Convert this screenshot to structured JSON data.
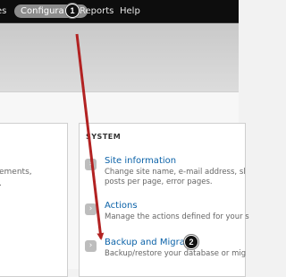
{
  "toolbar": {
    "items": [
      {
        "label": "es"
      },
      {
        "label": "Configuration"
      },
      {
        "label": "Reports"
      },
      {
        "label": "Help"
      }
    ]
  },
  "left_panel": {
    "lines": [
      "ements,",
      "."
    ]
  },
  "system": {
    "title": "SYSTEM",
    "items": [
      {
        "link": "Site information",
        "desc": [
          "Change site name, e-mail address, sl",
          "posts per page, error pages."
        ]
      },
      {
        "link": "Actions",
        "desc": [
          "Manage the actions defined for your s"
        ]
      },
      {
        "link": "Backup and Migrate",
        "desc": [
          "Backup/restore your database or mig"
        ]
      }
    ]
  },
  "annotations": {
    "step1": "1",
    "step2": "2",
    "arrow_color": "#b22222"
  }
}
